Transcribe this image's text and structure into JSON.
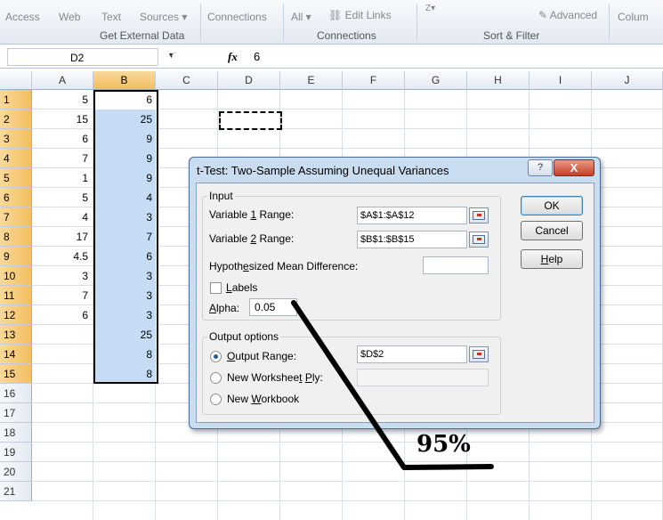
{
  "ribbon": {
    "access": "Access",
    "web": "Web",
    "text": "Text",
    "sources": "Sources ▾",
    "group_get_external": "Get External Data",
    "connections": "Connections",
    "all": "All ▾",
    "edit_links": "Edit Links",
    "group_connections": "Connections",
    "sort_label": "Z▾",
    "advanced": "Advanced",
    "group_sort_filter": "Sort & Filter",
    "column": "Colum"
  },
  "formula_bar": {
    "name_box": "D2",
    "fx": "fx",
    "value": "6"
  },
  "sheet": {
    "columns": [
      "A",
      "B",
      "C",
      "D",
      "E",
      "F",
      "G",
      "H",
      "I",
      "J"
    ],
    "rows": [
      "1",
      "2",
      "3",
      "4",
      "5",
      "6",
      "7",
      "8",
      "9",
      "10",
      "11",
      "12",
      "13",
      "14",
      "15",
      "16",
      "17",
      "18",
      "19",
      "20",
      "21"
    ],
    "col_a": [
      "5",
      "15",
      "6",
      "7",
      "1",
      "5",
      "4",
      "17",
      "4.5",
      "3",
      "7",
      "6"
    ],
    "col_b": [
      "6",
      "25",
      "9",
      "9",
      "9",
      "4",
      "3",
      "7",
      "6",
      "3",
      "3",
      "3",
      "25",
      "8",
      "8"
    ]
  },
  "dialog": {
    "title": "t-Test: Two-Sample Assuming Unequal Variances",
    "help_glyph": "?",
    "close_glyph": "X",
    "input_legend": "Input",
    "var1_label": "Variable 1 Range:",
    "var1_value": "$A$1:$A$12",
    "var2_label": "Variable 2 Range:",
    "var2_value": "$B$1:$B$15",
    "hyp_label": "Hypothesized Mean Difference:",
    "hyp_value": "",
    "labels_label": "Labels",
    "alpha_label": "Alpha:",
    "alpha_value": "0.05",
    "output_legend": "Output options",
    "output_range_label": "Output Range:",
    "output_range_value": "$D$2",
    "new_ply_label": "New Worksheet Ply:",
    "new_workbook_label": "New Workbook",
    "ok": "OK",
    "cancel": "Cancel",
    "help": "Help"
  },
  "annotation": {
    "text": "95%"
  }
}
